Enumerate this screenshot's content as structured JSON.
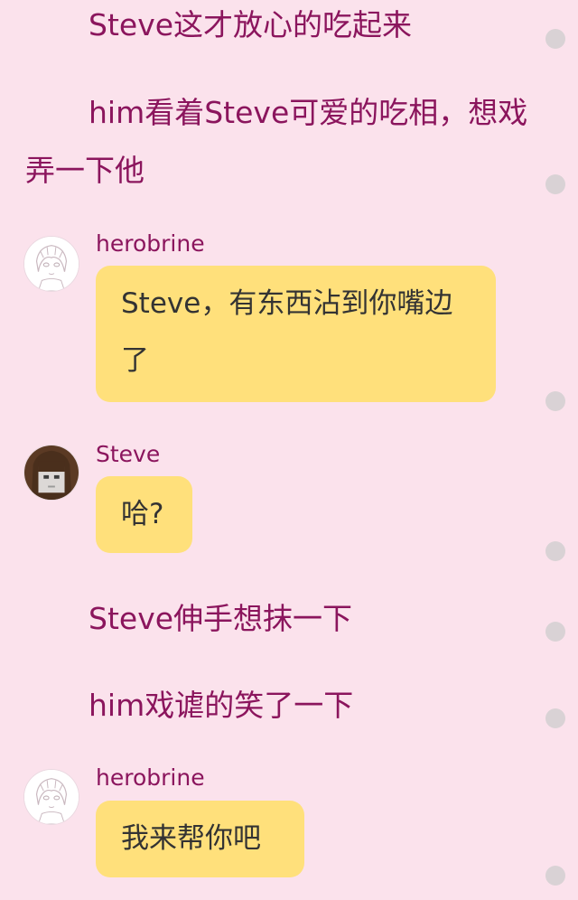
{
  "messages": [
    {
      "type": "narration",
      "text": "Steve这才放心的吃起来"
    },
    {
      "type": "narration",
      "text": "him看着Steve可爱的吃相，想戏弄一下他"
    },
    {
      "type": "chat",
      "speaker": "herobrine",
      "text": "Steve，有东西沾到你嘴边了",
      "avatar_icon": "herobrine-avatar-icon"
    },
    {
      "type": "chat",
      "speaker": "Steve",
      "text": "哈?",
      "avatar_icon": "steve-avatar-icon"
    },
    {
      "type": "narration",
      "text": "Steve伸手想抹一下"
    },
    {
      "type": "narration",
      "text": "him戏谑的笑了一下"
    },
    {
      "type": "chat",
      "speaker": "herobrine",
      "text": "我来帮你吧",
      "avatar_icon": "herobrine-avatar-icon"
    }
  ],
  "colors": {
    "background": "#fbe2ec",
    "narration_text": "#8b155d",
    "speaker_name": "#8b155d",
    "bubble": "#ffe07b",
    "bubble_text": "#333333",
    "side_dot": "#d9d2d5"
  }
}
